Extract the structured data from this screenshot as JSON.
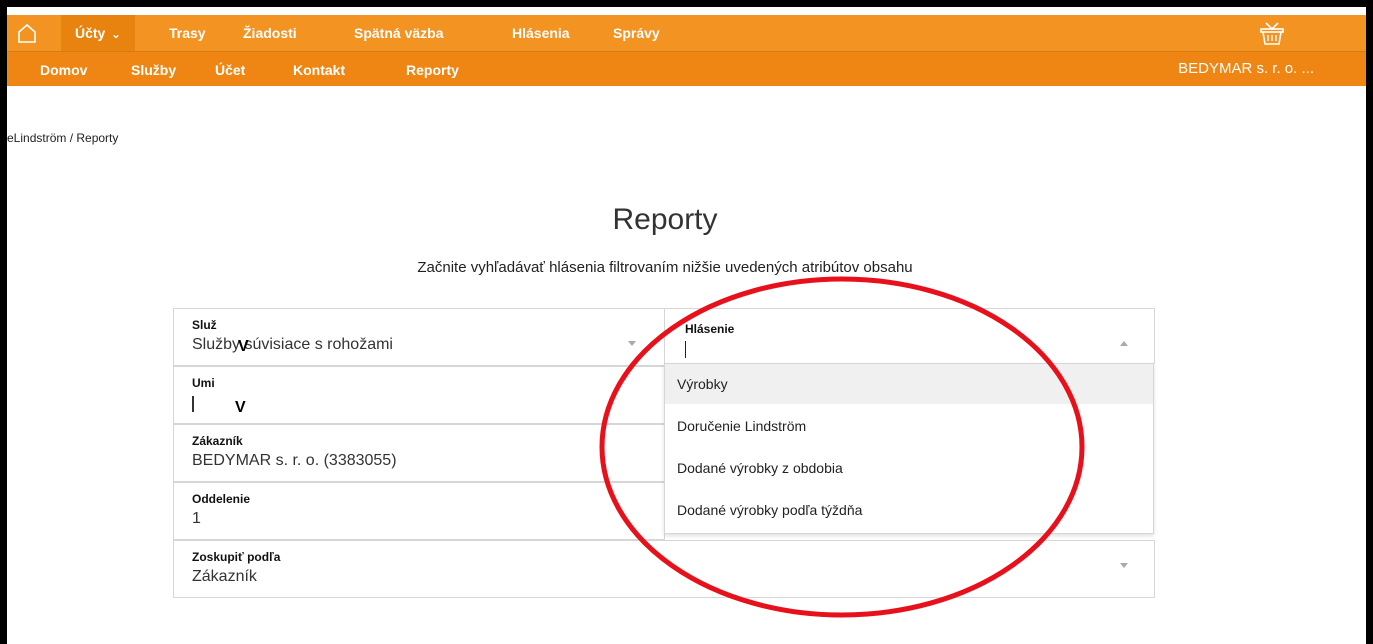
{
  "topnav": {
    "items": [
      {
        "label": "Účty",
        "has_dropdown": true,
        "active": true
      },
      {
        "label": "Trasy"
      },
      {
        "label": "Žiadosti"
      },
      {
        "label": "Spätná väzba"
      },
      {
        "label": "Hlásenia"
      },
      {
        "label": "Správy"
      }
    ],
    "icons": [
      "home-icon",
      "basket-icon"
    ]
  },
  "subnav": {
    "items": [
      {
        "label": "Domov"
      },
      {
        "label": "Služby"
      },
      {
        "label": "Účet"
      },
      {
        "label": "Kontakt"
      },
      {
        "label": "Reporty"
      }
    ],
    "company": "BEDYMAR s. r. o. ..."
  },
  "breadcrumb": "eLindström / Reporty",
  "page": {
    "title": "Reporty",
    "subtitle": "Začnite vyhľadávať hlásenia filtrovaním nižšie uvedených atribútov obsahu"
  },
  "filters": {
    "sluzby": {
      "label": "Služ",
      "value": "Služby súvisiace s rohožami",
      "overlay": "V"
    },
    "umiestnenie": {
      "label": "Umi",
      "value": "",
      "overlay": "V"
    },
    "zakaznik": {
      "label": "Zákazník",
      "value": "BEDYMAR s. r. o. (3383055)"
    },
    "oddelenie": {
      "label": "Oddelenie",
      "value": "1"
    },
    "zoskupit": {
      "label": "Zoskupiť podľa",
      "value": "Zákazník"
    },
    "hlasenie": {
      "label": "Hlásenie",
      "options": [
        "Výrobky",
        "Doručenie Lindström",
        "Dodané výrobky z obdobia",
        "Dodané výrobky podľa týždňa"
      ]
    }
  },
  "colors": {
    "topnav": "#f39322",
    "subnav": "#ef8614",
    "annotation": "#e8101b"
  }
}
